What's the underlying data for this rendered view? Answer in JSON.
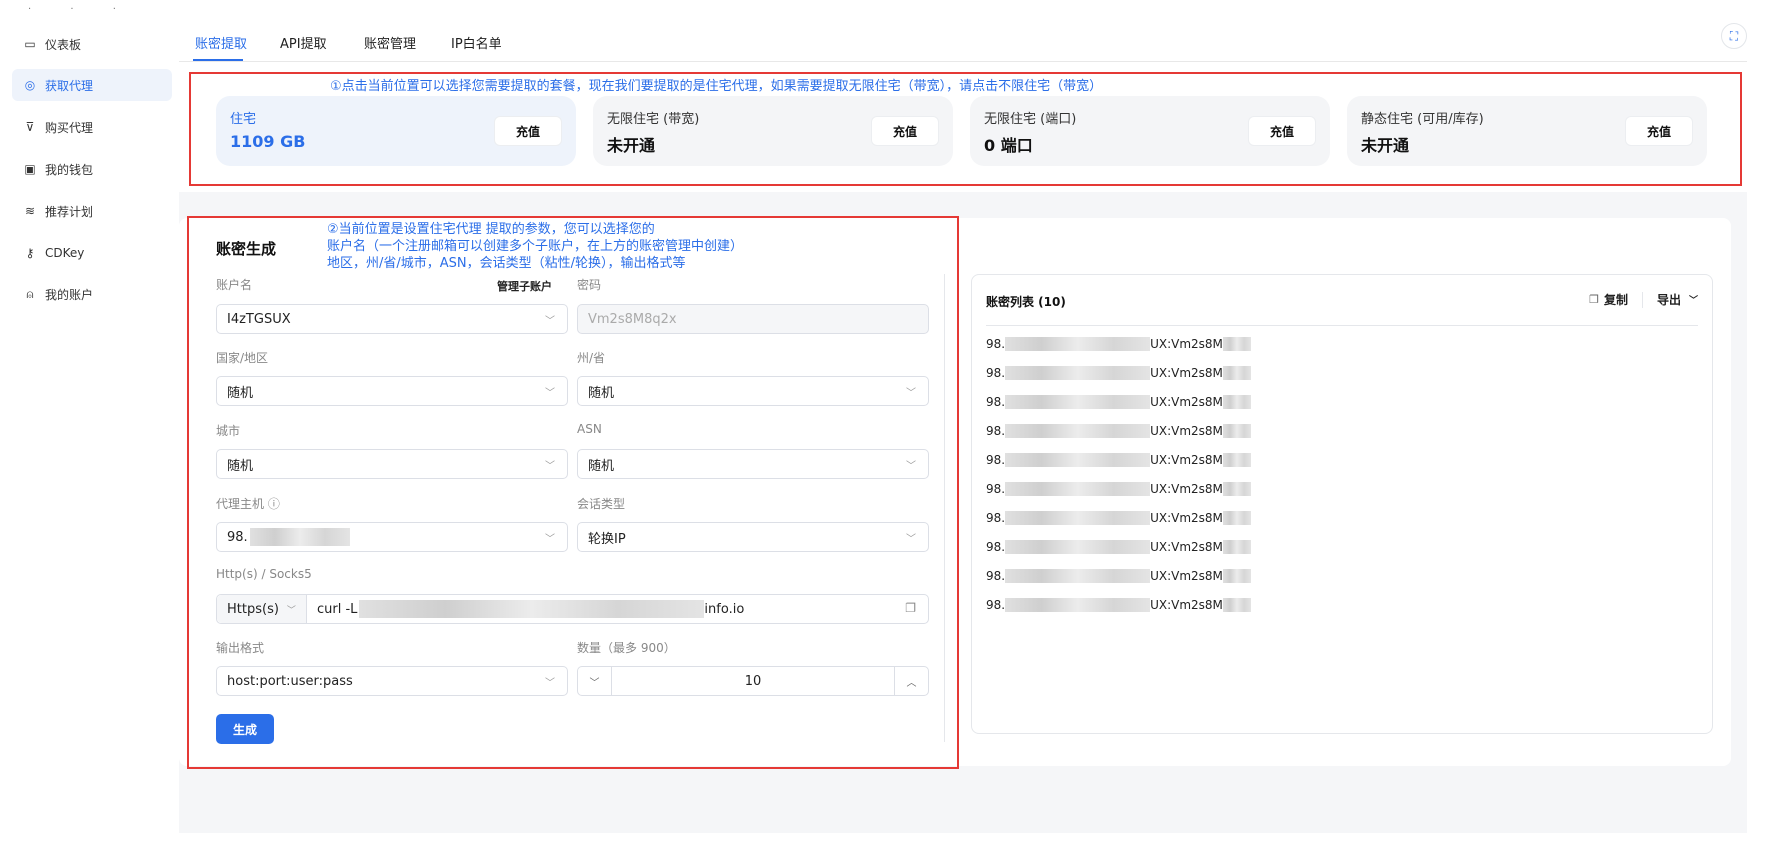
{
  "sidebar": {
    "items": [
      {
        "icon": "monitor-icon",
        "glyph": "▭",
        "label": "仪表板"
      },
      {
        "icon": "proxy-icon",
        "glyph": "◎",
        "label": "获取代理"
      },
      {
        "icon": "cart-icon",
        "glyph": "⊽",
        "label": "购买代理"
      },
      {
        "icon": "wallet-icon",
        "glyph": "▣",
        "label": "我的钱包"
      },
      {
        "icon": "referral-icon",
        "glyph": "≋",
        "label": "推荐计划"
      },
      {
        "icon": "key-icon",
        "glyph": "⚷",
        "label": "CDKey"
      },
      {
        "icon": "user-icon",
        "glyph": "⍝",
        "label": "我的账户"
      }
    ]
  },
  "tabs": [
    "账密提取",
    "API提取",
    "账密管理",
    "IP白名单"
  ],
  "annotation1": "①点击当前位置可以选择您需要提取的套餐，现在我们要提取的是住宅代理，如果需要提取无限住宅（带宽），请点击不限住宅（带宽）",
  "annotation2": [
    "②当前位置是设置住宅代理 提取的参数，您可以选择您的",
    "账户名（一个注册邮箱可以创建多个子账户，在上方的账密管理中创建）",
    "地区，州/省/城市，ASN，会话类型（粘性/轮换），输出格式等"
  ],
  "plans": [
    {
      "title": "住宅",
      "value": "1109 GB",
      "button": "充值"
    },
    {
      "title": "无限住宅 (带宽)",
      "value": "未开通",
      "button": "充值"
    },
    {
      "title": "无限住宅 (端口)",
      "value": "0 端口",
      "button": "充值"
    },
    {
      "title": "静态住宅 (可用/库存)",
      "value": "未开通",
      "button": "充值"
    }
  ],
  "generator": {
    "title": "账密生成",
    "account_label": "账户名",
    "manage_sub": "管理子账户",
    "account_value": "I4zTGSUX",
    "password_label": "密码",
    "password_value": "Vm2s8M8q2x",
    "country_label": "国家/地区",
    "country_value": "随机",
    "state_label": "州/省",
    "state_value": "随机",
    "city_label": "城市",
    "city_value": "随机",
    "asn_label": "ASN",
    "asn_value": "随机",
    "host_label": "代理主机 ⓘ",
    "host_prefix": "98.",
    "session_label": "会话类型",
    "session_value": "轮换IP",
    "protocol_label": "Http(s) / Socks5",
    "protocol_value": "Https(s)",
    "curl_prefix": "curl -L",
    "curl_suffix": "info.io",
    "format_label": "输出格式",
    "format_value": "host:port:user:pass",
    "qty_label": "数量（最多 900）",
    "qty_value": "10",
    "generate": "生成"
  },
  "list": {
    "title": "账密列表 (10)",
    "copy": "复制",
    "export": "导出",
    "row_prefix": "98.",
    "row_suffix": "UX:Vm2s8M",
    "rows": 10
  }
}
